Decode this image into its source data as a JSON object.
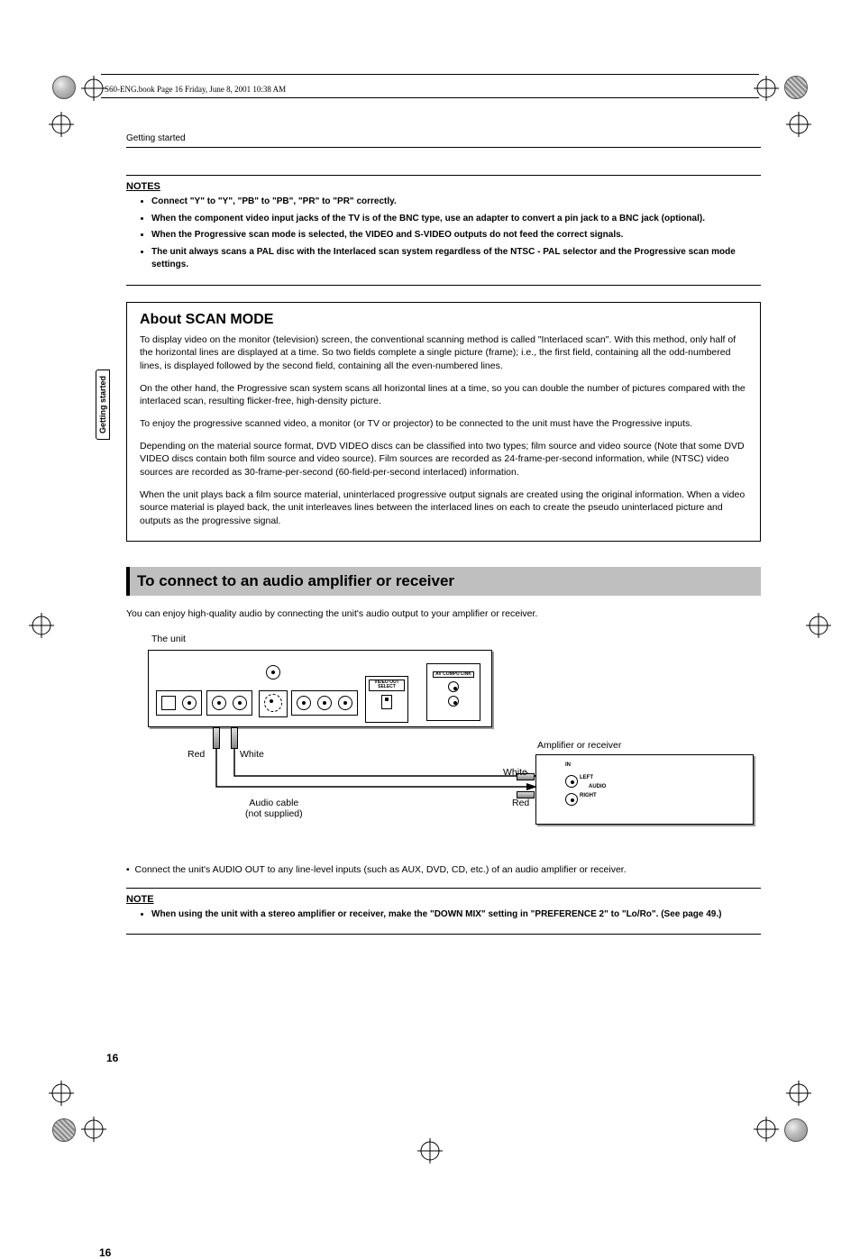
{
  "book_header": "S60-ENG.book  Page 16  Friday, June 8, 2001  10:38 AM",
  "running_head": "Getting started",
  "sidebar_tab": "Getting started",
  "notes1": {
    "title": "NOTES",
    "items": [
      "Connect \"Y\" to \"Y\", \"PB\" to \"PB\", \"PR\" to \"PR\" correctly.",
      "When the component video input jacks of the TV is of the BNC type, use an adapter to convert a pin jack to a BNC jack (optional).",
      "When the Progressive scan mode is selected, the VIDEO and S-VIDEO outputs do not feed the correct signals.",
      "The unit always scans a PAL disc with the Interlaced scan system regardless of the NTSC - PAL selector and the Progressive scan mode settings."
    ]
  },
  "scan": {
    "title": "About SCAN MODE",
    "p1": "To display video on the monitor (television) screen, the conventional scanning method is called \"Interlaced scan\". With this method, only half of the horizontal lines are displayed at a time. So two fields complete a single picture (frame); i.e., the first field, containing all the odd-numbered lines, is displayed followed by the second field, containing all the even-numbered lines.",
    "p2": "On the other hand, the Progressive scan system scans all horizontal lines at a time, so you can double the number of pictures compared with the interlaced scan, resulting flicker-free, high-density picture.",
    "p3": "To enjoy the progressive scanned video, a monitor (or TV or projector) to be connected to the unit must have the Progressive inputs.",
    "p4": "Depending on the material source format, DVD VIDEO discs can be classified into two types; film source and video source (Note that some DVD VIDEO discs contain both film source and video source). Film sources are recorded as 24-frame-per-second information, while (NTSC) video sources are recorded as 30-frame-per-second (60-field-per-second interlaced) information.",
    "p5": "When the unit plays back a film source material, uninterlaced progressive output signals are created using the original information. When a video source material is played back, the unit interleaves lines between the interlaced lines on each to create the pseudo uninterlaced picture and outputs as the progressive signal."
  },
  "section_title": "To connect to an audio amplifier or receiver",
  "intro": "You can enjoy high-quality audio by connecting the unit's audio output to your amplifier or receiver.",
  "diagram": {
    "unit_label": "The unit",
    "amp_label": "Amplifier or receiver",
    "red": "Red",
    "white": "White",
    "cable": "Audio cable",
    "not_supplied": "(not supplied)",
    "av_compu": "AV COMPU LINK",
    "video_out": "VIDEO OUT SELECT",
    "in": "IN",
    "left": "LEFT",
    "right": "RIGHT",
    "audio": "AUDIO"
  },
  "connect_note": "Connect the unit's AUDIO OUT to any line-level inputs (such as AUX, DVD, CD, etc.) of an audio amplifier or receiver.",
  "notes2": {
    "title": "NOTE",
    "item": "When using the unit with a stereo amplifier or receiver, make the \"DOWN MIX\" setting in \"PREFERENCE 2\" to \"Lo/Ro\". (See page 49.)"
  },
  "page_number": "16",
  "chart_data": null
}
